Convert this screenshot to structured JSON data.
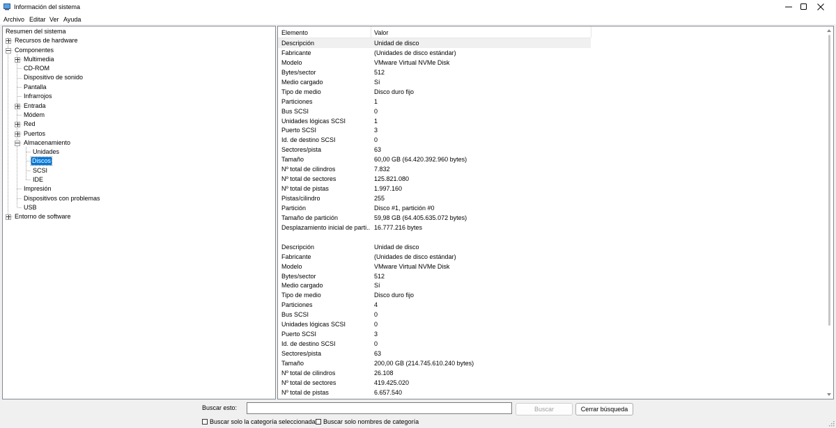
{
  "window": {
    "title": "Información del sistema",
    "minimize_glyph": "—",
    "maximize_glyph": "☐",
    "close_glyph": "✕"
  },
  "menu": [
    "Archivo",
    "Editar",
    "Ver",
    "Ayuda"
  ],
  "tree": {
    "root": "Resumen del sistema",
    "hardware": "Recursos de hardware",
    "components": "Componentes",
    "multimedia": "Multimedia",
    "cdrom": "CD-ROM",
    "sound": "Dispositivo de sonido",
    "display": "Pantalla",
    "infrared": "Infrarrojos",
    "input": "Entrada",
    "modem": "Módem",
    "network": "Red",
    "ports": "Puertos",
    "storage": "Almacenamiento",
    "drives": "Unidades",
    "disks": "Discos",
    "scsi": "SCSI",
    "ide": "IDE",
    "printing": "Impresión",
    "problem_devices": "Dispositivos con problemas",
    "usb": "USB",
    "software": "Entorno de software"
  },
  "details": {
    "col_item": "Elemento",
    "col_value": "Valor",
    "rows": [
      [
        "Descripción",
        "Unidad de disco"
      ],
      [
        "Fabricante",
        "(Unidades de disco estándar)"
      ],
      [
        "Modelo",
        "VMware Virtual NVMe Disk"
      ],
      [
        "Bytes/sector",
        "512"
      ],
      [
        "Medio cargado",
        "Sí"
      ],
      [
        "Tipo de medio",
        "Disco duro fijo"
      ],
      [
        "Particiones",
        "1"
      ],
      [
        "Bus SCSI",
        "0"
      ],
      [
        "Unidades lógicas SCSI",
        "1"
      ],
      [
        "Puerto SCSI",
        "3"
      ],
      [
        "Id. de destino SCSI",
        "0"
      ],
      [
        "Sectores/pista",
        "63"
      ],
      [
        "Tamaño",
        "60,00 GB (64.420.392.960 bytes)"
      ],
      [
        "Nº total de cilindros",
        "7.832"
      ],
      [
        "Nº total de sectores",
        "125.821.080"
      ],
      [
        "Nº total de pistas",
        "1.997.160"
      ],
      [
        "Pistas/cilindro",
        "255"
      ],
      [
        "Partición",
        "Disco #1, partición #0"
      ],
      [
        "Tamaño de partición",
        "59,98 GB (64.405.635.072 bytes)"
      ],
      [
        "Desplazamiento inicial de parti...",
        "16.777.216 bytes"
      ],
      [
        "",
        ""
      ],
      [
        "Descripción",
        "Unidad de disco"
      ],
      [
        "Fabricante",
        "(Unidades de disco estándar)"
      ],
      [
        "Modelo",
        "VMware Virtual NVMe Disk"
      ],
      [
        "Bytes/sector",
        "512"
      ],
      [
        "Medio cargado",
        "Sí"
      ],
      [
        "Tipo de medio",
        "Disco duro fijo"
      ],
      [
        "Particiones",
        "4"
      ],
      [
        "Bus SCSI",
        "0"
      ],
      [
        "Unidades lógicas SCSI",
        "0"
      ],
      [
        "Puerto SCSI",
        "3"
      ],
      [
        "Id. de destino SCSI",
        "0"
      ],
      [
        "Sectores/pista",
        "63"
      ],
      [
        "Tamaño",
        "200,00 GB (214.745.610.240 bytes)"
      ],
      [
        "Nº total de cilindros",
        "26.108"
      ],
      [
        "Nº total de sectores",
        "419.425.020"
      ],
      [
        "Nº total de pistas",
        "6.657.540"
      ]
    ]
  },
  "search": {
    "label": "Buscar esto:",
    "value": "",
    "find_button": "Buscar",
    "close_button": "Cerrar búsqueda",
    "only_selected_category": "Buscar solo la categoría seleccionada",
    "only_category_names": "Buscar solo nombres de categoría"
  },
  "colors": {
    "selection": "#0078d7",
    "border": "#828790"
  }
}
